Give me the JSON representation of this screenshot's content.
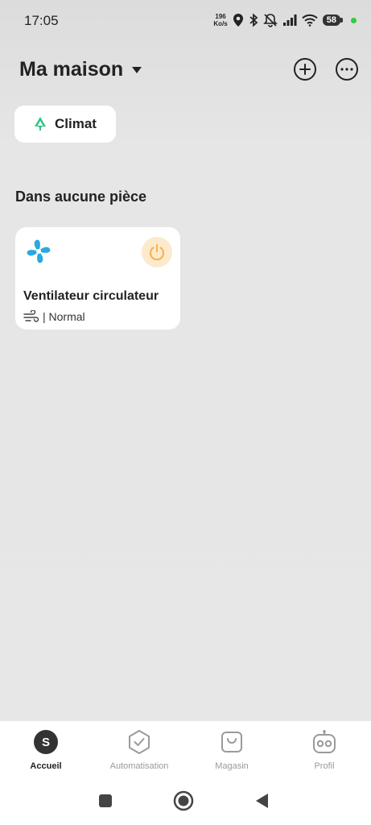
{
  "status": {
    "time": "17:05",
    "net_speed_value": "196",
    "net_speed_unit": "Ko/s",
    "battery": "58"
  },
  "header": {
    "title": "Ma maison"
  },
  "scene_chip": {
    "label": "Climat"
  },
  "section": {
    "title": "Dans aucune pièce"
  },
  "device": {
    "name": "Ventilateur circulateur",
    "mode": "| Normal",
    "icon_color": "#2aa8e0",
    "power_color": "#f5b24a"
  },
  "nav": {
    "items": [
      {
        "label": "Accueil",
        "avatar_letter": "S"
      },
      {
        "label": "Automatisation"
      },
      {
        "label": "Magasin"
      },
      {
        "label": "Profil"
      }
    ]
  }
}
